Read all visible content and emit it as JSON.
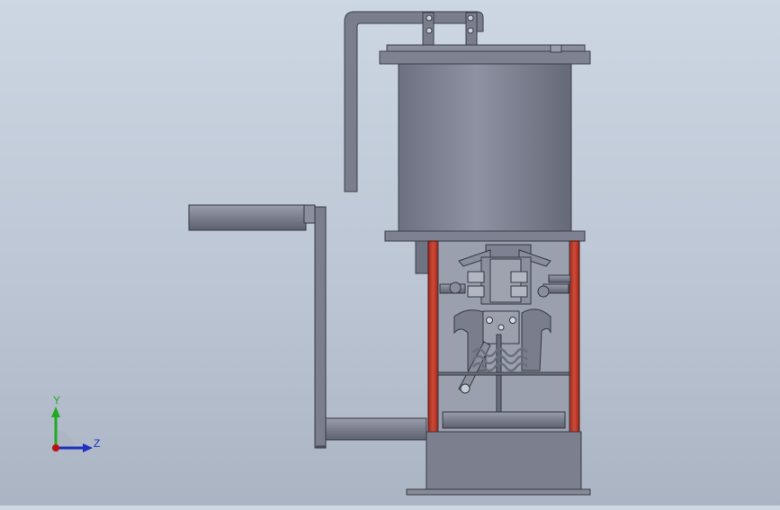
{
  "viewport": {
    "background_top": "#cdd6e3",
    "background_bottom": "#aab4c3"
  },
  "triad": {
    "y_label": "Y",
    "z_label": "Z",
    "y_color": "#1faa1f",
    "z_color": "#2030c0",
    "x_color": "#c01010"
  },
  "model": {
    "metal_color": "#7d8191",
    "frame_color": "#c0392b",
    "spring_color": "#8e8e98"
  }
}
